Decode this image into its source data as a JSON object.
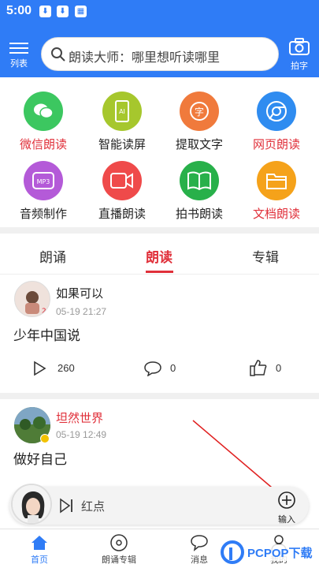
{
  "status": {
    "time": "5:00"
  },
  "header": {
    "menu_label": "列表",
    "search_placeholder": "朗读大师：哪里想听读哪里",
    "camera_label": "拍字"
  },
  "features": [
    {
      "label": "微信朗读",
      "icon": "wechat-icon",
      "color": "#3cc760",
      "highlight": true
    },
    {
      "label": "智能读屏",
      "icon": "ai-screen-icon",
      "color": "#a6c72d",
      "highlight": false
    },
    {
      "label": "提取文字",
      "icon": "extract-text-icon",
      "color": "#f07a3c",
      "highlight": false
    },
    {
      "label": "网页朗读",
      "icon": "browser-icon",
      "color": "#2f8cf0",
      "highlight": true
    },
    {
      "label": "音频制作",
      "icon": "mp3-icon",
      "color": "#b45ad8",
      "highlight": false
    },
    {
      "label": "直播朗读",
      "icon": "video-icon",
      "color": "#ef4a4a",
      "highlight": false
    },
    {
      "label": "拍书朗读",
      "icon": "book-icon",
      "color": "#28b04a",
      "highlight": false
    },
    {
      "label": "文档朗读",
      "icon": "folder-icon",
      "color": "#f5a21a",
      "highlight": true
    }
  ],
  "tabs": [
    {
      "label": "朗诵",
      "active": false
    },
    {
      "label": "朗读",
      "active": true
    },
    {
      "label": "专辑",
      "active": false
    }
  ],
  "posts": [
    {
      "user": "如果可以",
      "date": "05-19 21:27",
      "title": "少年中国说",
      "plays": "260",
      "comments": "0",
      "likes": "0",
      "user_color": "#222"
    },
    {
      "user": "坦然世界",
      "date": "05-19 12:49",
      "title": "做好自己",
      "user_color": "#e0303a"
    }
  ],
  "player": {
    "track": "红点",
    "input_label": "输入"
  },
  "nav": [
    {
      "label": "首页",
      "active": true
    },
    {
      "label": "朗诵专辑",
      "active": false
    },
    {
      "label": "消息",
      "active": false
    },
    {
      "label": "我的",
      "active": false
    }
  ],
  "watermark": {
    "text": "PCPOP下载"
  },
  "colors": {
    "brand": "#2f7cf6",
    "accent": "#e0303a"
  }
}
